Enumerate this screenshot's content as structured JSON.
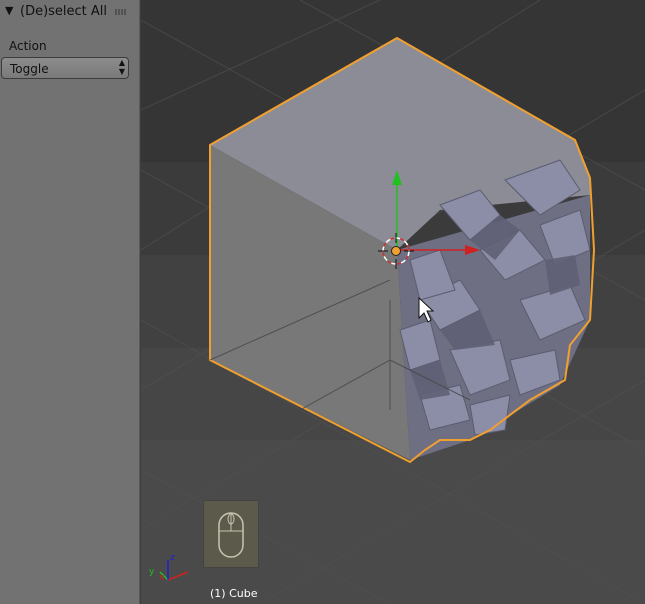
{
  "panel": {
    "title": "(De)select All",
    "collapse_icon": "triangle-down-icon",
    "action_label": "Action",
    "action_value": "Toggle"
  },
  "viewport": {
    "object_label": "(1) Cube",
    "axes": {
      "x": "x",
      "y": "y",
      "z": "z"
    },
    "colors": {
      "selection_outline": "#f0a030",
      "x_axis": "#d02020",
      "y_axis": "#20c020",
      "z_axis": "#2020d0"
    }
  }
}
